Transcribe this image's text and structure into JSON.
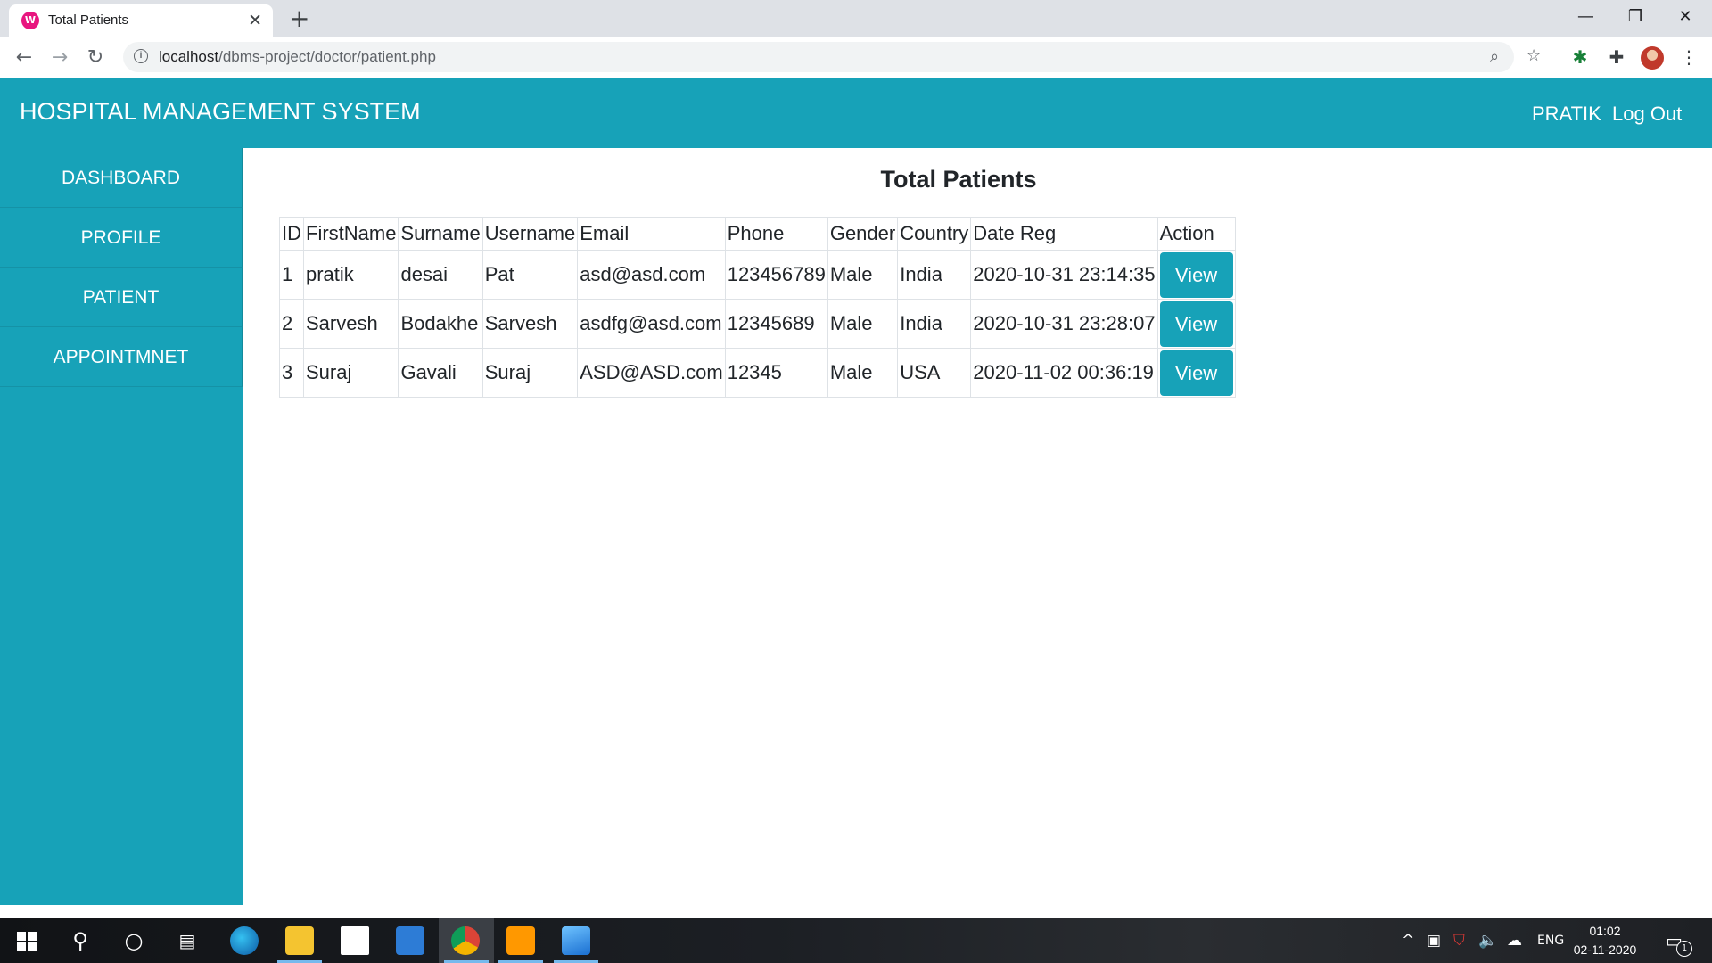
{
  "browser": {
    "tab_title": "Total Patients",
    "tab_favicon_letter": "W",
    "url_host": "localhost",
    "url_path": "/dbms-project/doctor/patient.php"
  },
  "header": {
    "brand": "HOSPITAL MANAGEMENT SYSTEM",
    "user": "PRATIK",
    "logout": "Log Out"
  },
  "sidebar": {
    "items": [
      {
        "label": "DASHBOARD"
      },
      {
        "label": "PROFILE"
      },
      {
        "label": "PATIENT"
      },
      {
        "label": "APPOINTMNET"
      }
    ]
  },
  "main": {
    "title": "Total Patients",
    "table": {
      "columns": [
        "ID",
        "FirstName",
        "Surname",
        "Username",
        "Email",
        "Phone",
        "Gender",
        "Country",
        "Date Reg",
        "Action"
      ],
      "rows": [
        {
          "id": "1",
          "firstname": "pratik",
          "surname": "desai",
          "username": "Pat",
          "email": "asd@asd.com",
          "phone": "123456789",
          "gender": "Male",
          "country": "India",
          "date_reg": "2020-10-31 23:14:35",
          "action": "View"
        },
        {
          "id": "2",
          "firstname": "Sarvesh",
          "surname": "Bodakhe",
          "username": "Sarvesh",
          "email": "asdfg@asd.com",
          "phone": "12345689",
          "gender": "Male",
          "country": "India",
          "date_reg": "2020-10-31 23:28:07",
          "action": "View"
        },
        {
          "id": "3",
          "firstname": "Suraj",
          "surname": "Gavali",
          "username": "Suraj",
          "email": "ASD@ASD.com",
          "phone": "12345",
          "gender": "Male",
          "country": "USA",
          "date_reg": "2020-11-02 00:36:19",
          "action": "View"
        }
      ]
    }
  },
  "taskbar": {
    "language": "ENG",
    "time": "01:02",
    "date": "02-11-2020",
    "notification_count": "1"
  },
  "colors": {
    "primary": "#17a2b8",
    "tab_strip": "#dee1e6",
    "taskbar": "#1c1f24"
  }
}
